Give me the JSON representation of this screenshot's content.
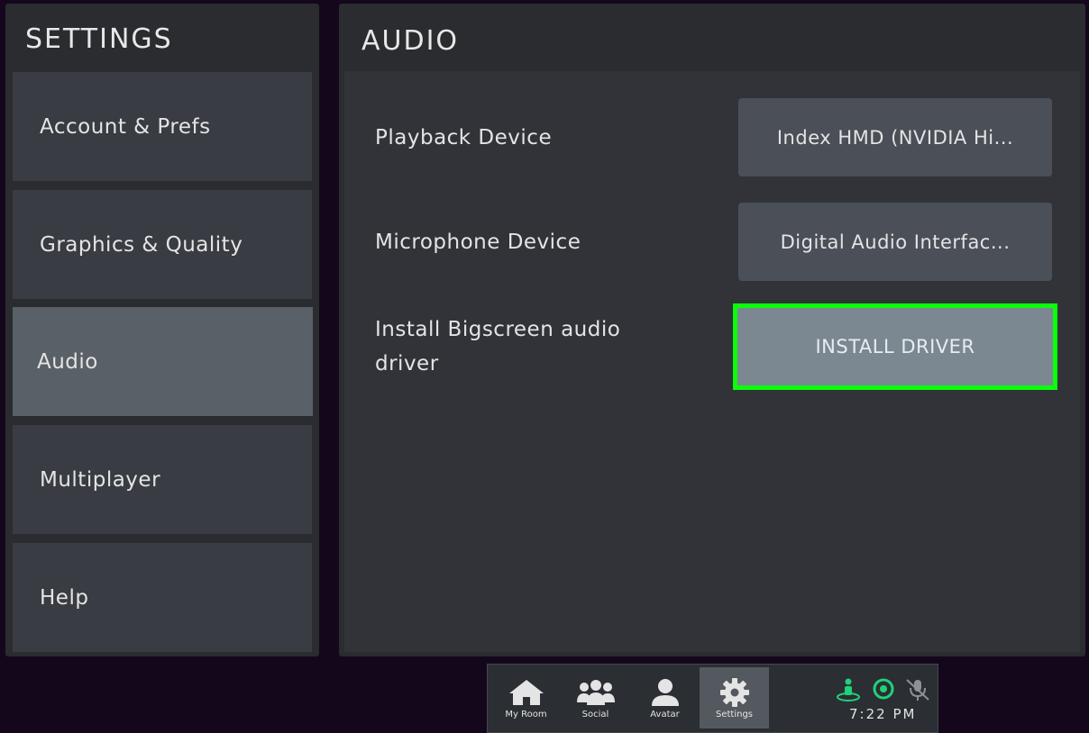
{
  "sidebar": {
    "title": "SETTINGS",
    "items": [
      {
        "label": "Account & Prefs"
      },
      {
        "label": "Graphics & Quality"
      },
      {
        "label": "Audio"
      },
      {
        "label": "Multiplayer"
      },
      {
        "label": "Help"
      }
    ]
  },
  "main": {
    "title": "AUDIO",
    "rows": [
      {
        "label": "Playback Device",
        "value": "Index HMD (NVIDIA Hi..."
      },
      {
        "label": "Microphone Device",
        "value": "Digital Audio Interfac..."
      },
      {
        "label": "Install Bigscreen audio driver",
        "button": "INSTALL DRIVER"
      }
    ]
  },
  "taskbar": {
    "items": [
      {
        "label": "My Room",
        "icon": "home-icon"
      },
      {
        "label": "Social",
        "icon": "group-icon"
      },
      {
        "label": "Avatar",
        "icon": "person-icon"
      },
      {
        "label": "Settings",
        "icon": "gear-icon"
      }
    ],
    "status_icons": [
      "user-presence-icon",
      "target-icon",
      "mic-muted-icon"
    ],
    "clock": "7:22 PM",
    "accent": "#1fd17a"
  },
  "colors": {
    "background": "#14071c",
    "panel": "#2a2c30",
    "item": "#393c42",
    "item_active": "#5a6068",
    "highlight": "#0bff0b"
  }
}
